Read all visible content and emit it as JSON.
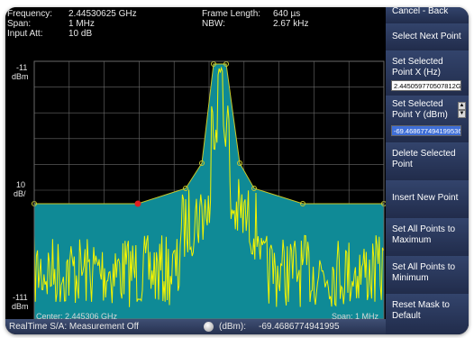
{
  "header": {
    "frequency_label": "Frequency:",
    "frequency_value": "2.44530625 GHz",
    "span_label": "Span:",
    "span_value": "1 MHz",
    "input_att_label": "Input Att:",
    "input_att_value": "10 dB",
    "frame_length_label": "Frame Length:",
    "frame_length_value": "640 µs",
    "nbw_label": "NBW:",
    "nbw_value": "2.67 kHz"
  },
  "plot": {
    "ref_level": "-11",
    "ref_unit": "dBm",
    "scale": "10",
    "scale_unit": "dB/",
    "bottom_level": "-111",
    "bottom_unit": "dBm",
    "center": "Center: 2.445306 GHz",
    "span": "Span: 1 MHz",
    "colors": {
      "fill": "#0f8a96",
      "mask": "#c8c82a",
      "trace": "#f4f400",
      "grid": "#6a6a6a",
      "selected_point": "#e02020"
    }
  },
  "status": {
    "left_text": "RealTime S/A: Measurement Off",
    "knob_icon": "knob-icon",
    "unit_text": "(dBm):",
    "value_text": "-69.4686774941995"
  },
  "sidebar": {
    "cancel_back": "Cancel - Back",
    "select_next": "Select Next Point",
    "set_x_line1": "Set Selected",
    "set_x_line2": "Point X (Hz)",
    "x_value": "2.445059770507812G",
    "set_y_line1": "Set Selected",
    "set_y_line2": "Point Y (dBm)",
    "y_value": "-69.468677494199536",
    "delete_line1": "Delete Selected",
    "delete_line2": "Point",
    "insert": "Insert New Point",
    "set_max_line1": "Set All Points to",
    "set_max_line2": "Maximum",
    "set_min_line1": "Set All Points to",
    "set_min_line2": "Minimum",
    "reset_line1": "Reset Mask to",
    "reset_line2": "Default",
    "spin_up_icon": "spin-up-icon",
    "spin_down_icon": "spin-down-icon"
  }
}
